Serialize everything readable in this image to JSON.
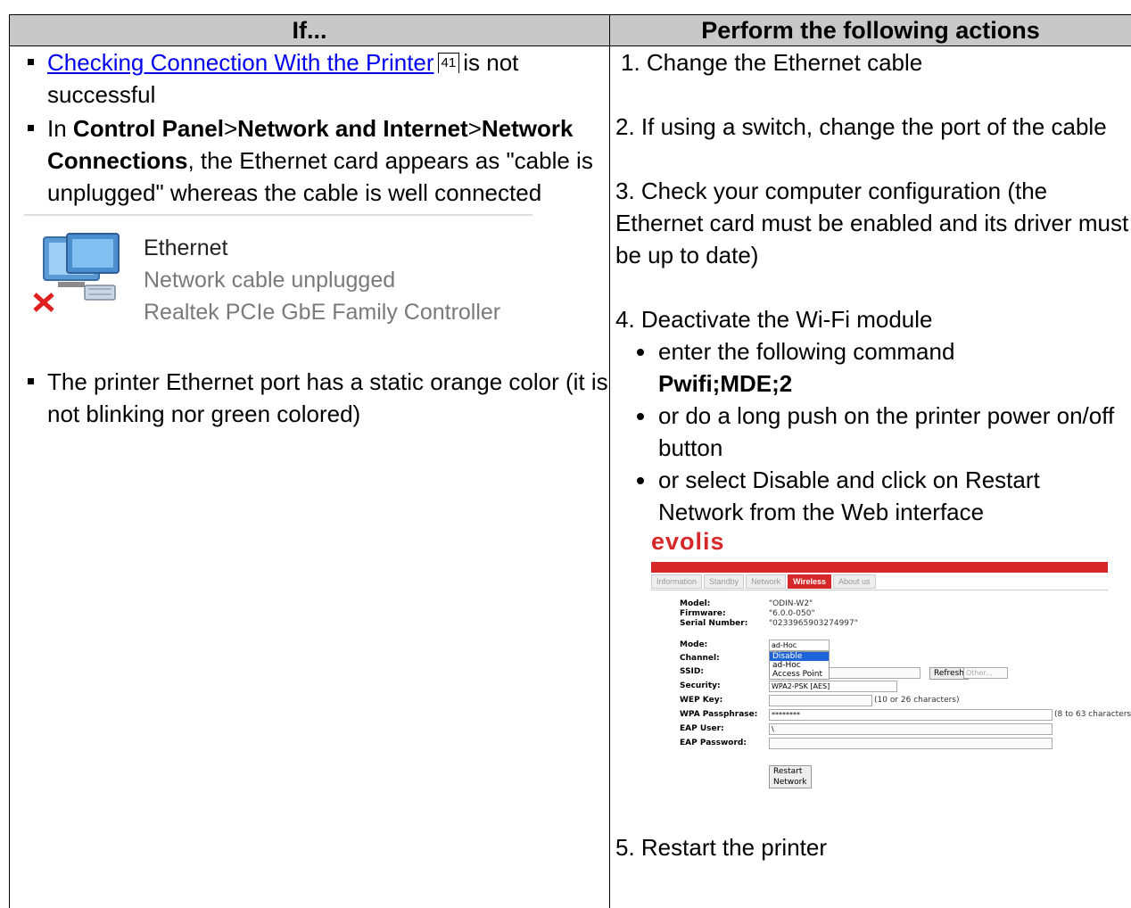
{
  "table": {
    "header_left": "If...",
    "header_right": "Perform the following actions"
  },
  "left": {
    "bullet1_link": "Checking Connection With the Printer",
    "bullet1_pageref": "41",
    "bullet1_rest": "is not successful",
    "bullet2_pre": "In ",
    "bullet2_b1": "Control Panel",
    "bullet2_sep1": ">",
    "bullet2_b2": "Network and Internet",
    "bullet2_sep2": ">",
    "bullet2_b3": "Network Connections",
    "bullet2_rest": ", the Ethernet card appears as \"cable is unplugged\" whereas the cable is well connected",
    "netcard": {
      "title": "Ethernet",
      "status": "Network cable unplugged",
      "adapter": "Realtek PCIe GbE Family Controller"
    },
    "bullet3": "The printer Ethernet port has a static orange color (it is not blinking nor green colored)"
  },
  "right": {
    "step1": "1. Change the Ethernet cable",
    "step2": "2. If using a switch, change the port of the cable",
    "step3": "3. Check your computer configuration (the Ethernet card must be enabled and its driver must be up to date)",
    "step4": "4. Deactivate the Wi-Fi module",
    "step4_sub1_pre": "enter the following command",
    "step4_sub1_cmd": "Pwifi;MDE;2",
    "step4_sub2": "or do a long push on the printer power on/off button",
    "step4_sub3": "or select Disable and click on Restart Network from the Web interface",
    "step5": "5. Restart the printer"
  },
  "web": {
    "logo": "evolis",
    "tabs": [
      "Information",
      "Standby",
      "Network",
      "Wireless",
      "About us"
    ],
    "active_tab": "Wireless",
    "model_label": "Model:",
    "model_value": "\"ODIN-W2\"",
    "firmware_label": "Firmware:",
    "firmware_value": "\"6.0.0-050\"",
    "serial_label": "Serial Number:",
    "serial_value": "\"0233965903274997\"",
    "mode_label": "Mode:",
    "mode_value": "ad-Hoc",
    "mode_options": [
      "Disable",
      "ad-Hoc",
      "Access Point"
    ],
    "channel_label": "Channel:",
    "ssid_label": "SSID:",
    "refresh_label": "Refresh",
    "other_label": "Other...",
    "security_label": "Security:",
    "security_value": "WPA2-PSK [AES]",
    "wep_label": "WEP Key:",
    "wep_hint": "(10 or 26 characters)",
    "wpa_label": "WPA Passphrase:",
    "wpa_value": "********",
    "wpa_hint": "(8 to 63 characters)",
    "eap_user_label": "EAP User:",
    "eap_user_value": "\\",
    "eap_pass_label": "EAP Password:",
    "restart_label": "Restart Network"
  },
  "colors": {
    "brand_red": "#d62828",
    "link_blue": "#0000ee",
    "header_gray": "#c8c8c8"
  }
}
